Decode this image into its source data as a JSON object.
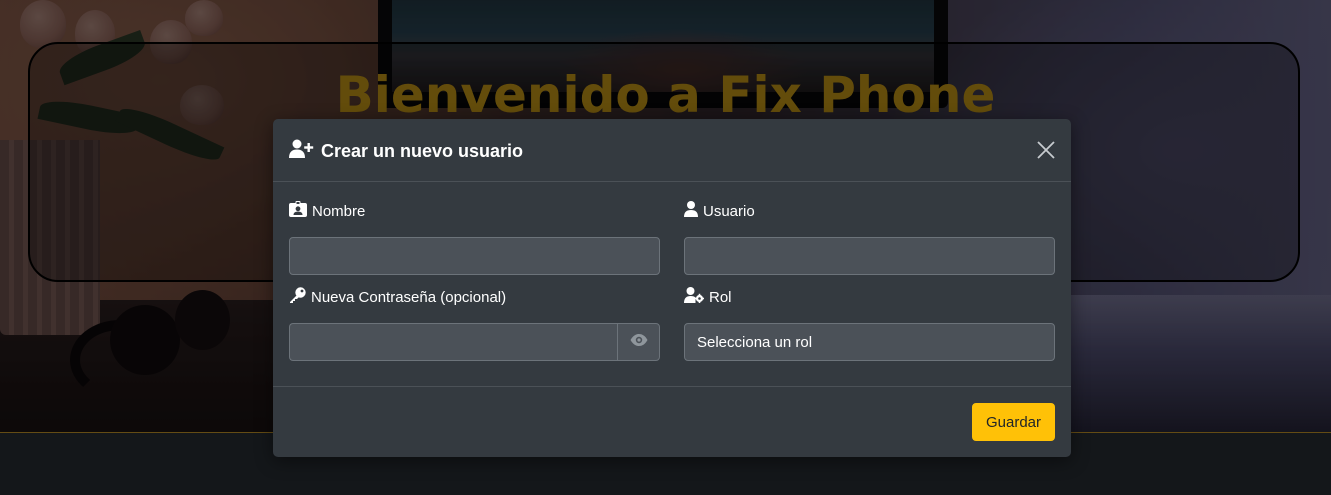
{
  "hero": {
    "title": "Bienvenido a Fix Phone"
  },
  "modal": {
    "title": "Crear un nuevo usuario",
    "title_icon": "user-plus-icon",
    "close_icon": "close-icon",
    "fields": {
      "nombre": {
        "label": "Nombre",
        "icon": "id-card-icon",
        "value": ""
      },
      "usuario": {
        "label": "Usuario",
        "icon": "user-icon",
        "value": ""
      },
      "password": {
        "label": "Nueva Contraseña (opcional)",
        "icon": "key-icon",
        "value": "",
        "toggle_icon": "eye-icon"
      },
      "rol": {
        "label": "Rol",
        "icon": "user-gear-icon",
        "selected": "Selecciona un rol"
      }
    },
    "save_label": "Guardar"
  },
  "colors": {
    "modal_bg": "#343a40",
    "input_bg": "#4b5158",
    "accent": "#ffc107",
    "hero_title": "#8a6a10"
  }
}
